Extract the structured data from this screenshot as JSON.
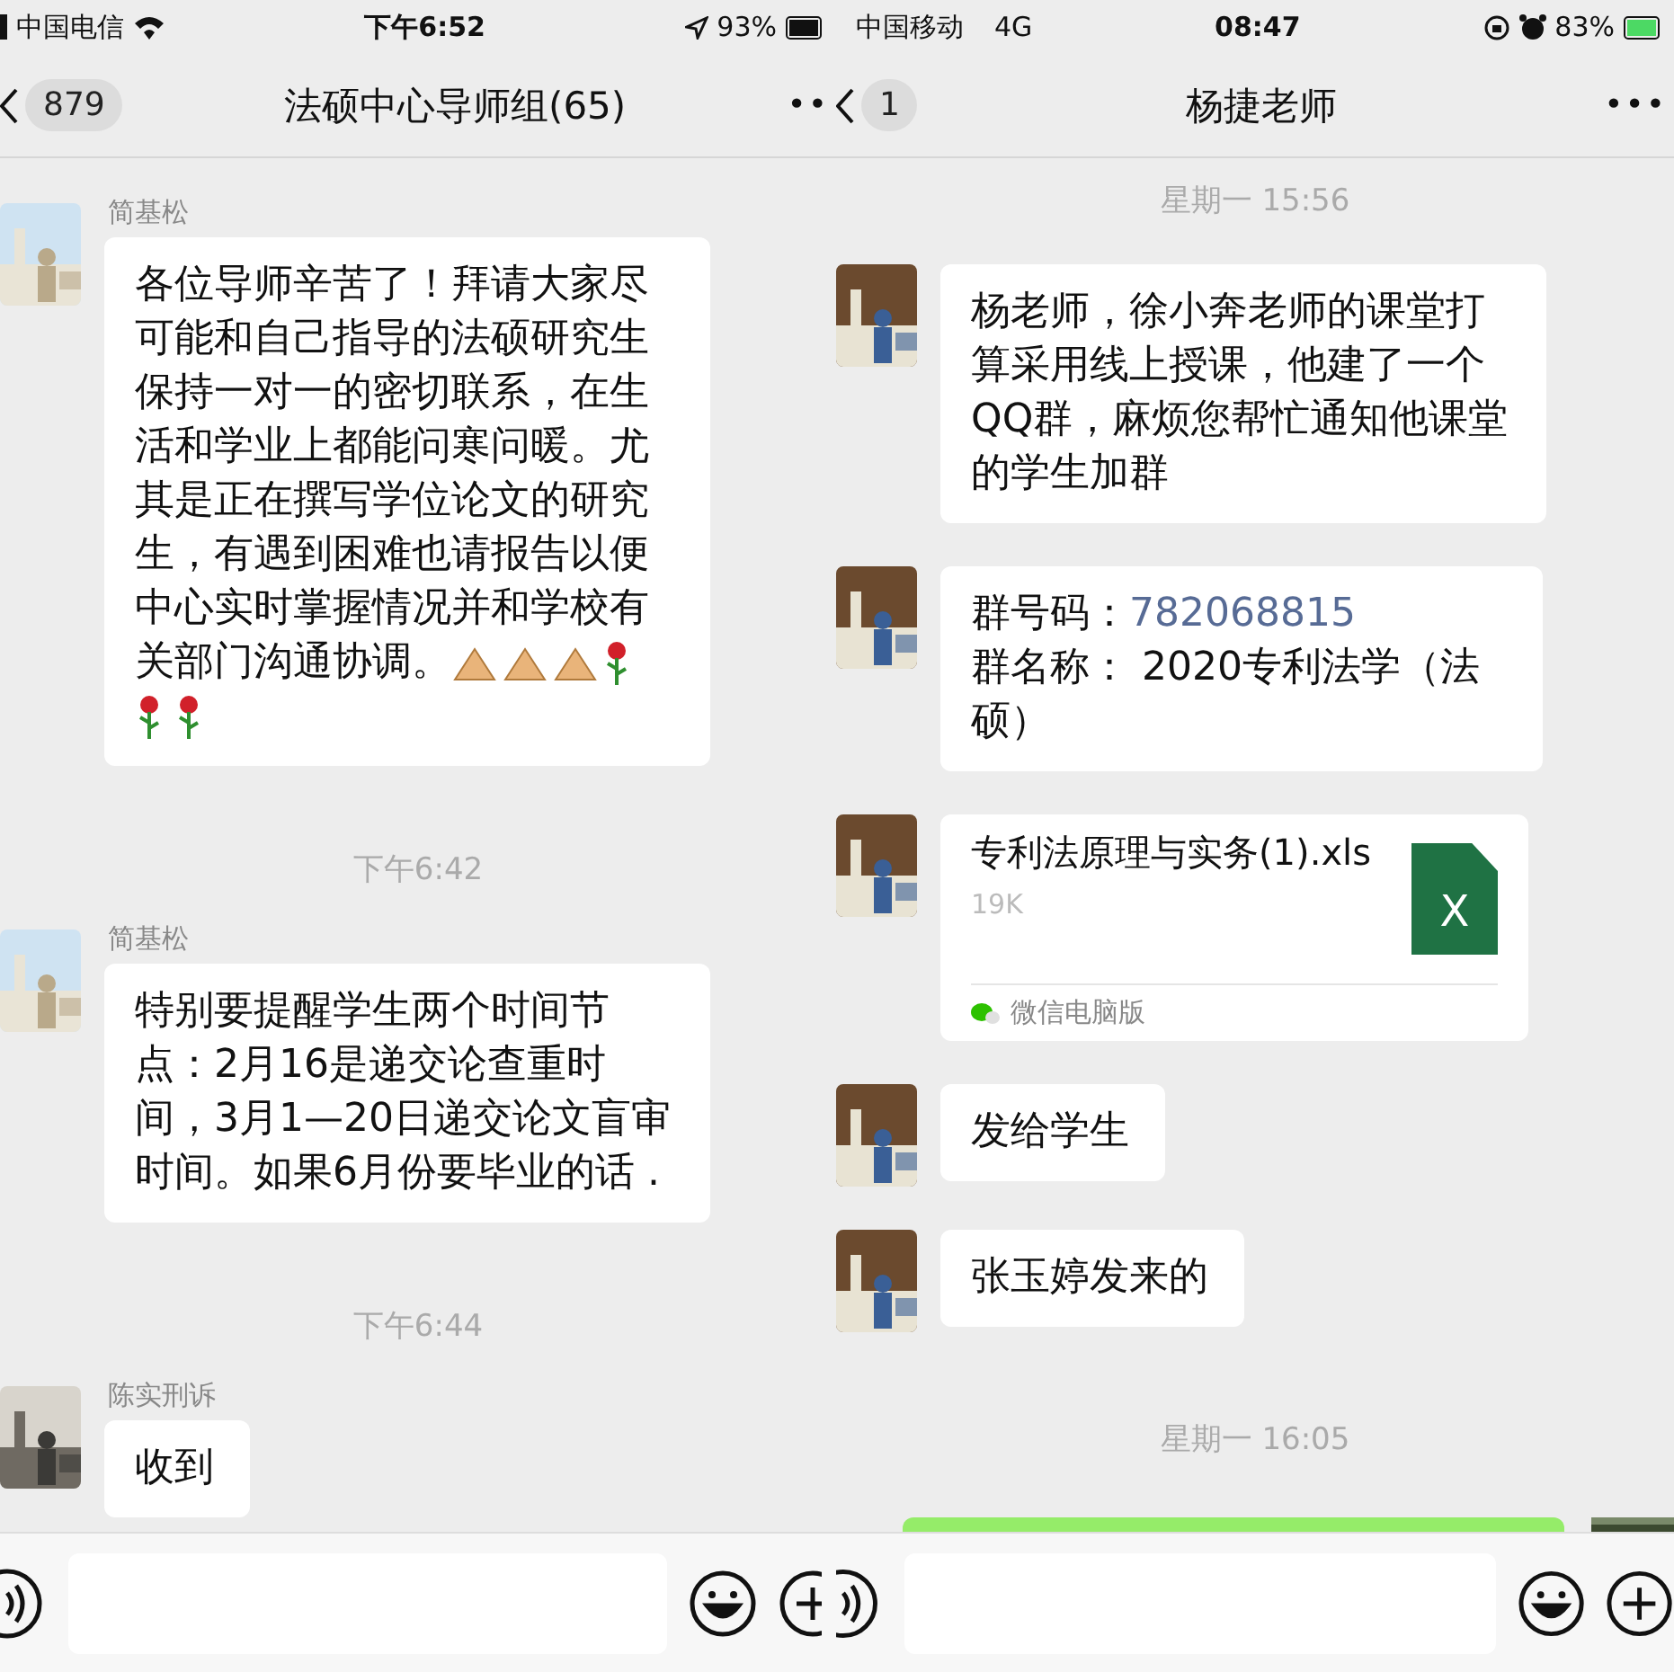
{
  "panes": [
    {
      "status_bar": {
        "kind": "wifi",
        "carrier": "中国电信",
        "time": "下午6:52",
        "battery": "93%"
      },
      "header": {
        "unread": "879",
        "title": "法硕中心导师组(65)",
        "more": "••"
      },
      "messages": [
        {
          "kind": "emoji_text",
          "sender": "简基松",
          "text": "各位导师辛苦了！拜请大家尽可能和自己指导的法硕研究生保持一对一的密切联系，在生活和学业上都能问寒问暖。尤其是正在撰写学位论文的研究生，有遇到困难也请报告以便中心实时掌握情况并和学校有关部门沟通协调。"
        },
        {
          "kind": "time",
          "text": "下午6:42"
        },
        {
          "kind": "text",
          "sender": "简基松",
          "text": "特别要提醒学生两个时间节点：2月16是递交论查重时间，3月1—20日递交论文盲审时间。如果6月份要毕业的话 ."
        },
        {
          "kind": "time",
          "text": "下午6:44"
        },
        {
          "kind": "text",
          "sender": "陈实刑诉",
          "text": "收到"
        }
      ]
    },
    {
      "status_bar": {
        "kind": "cellular",
        "carrier": "中国移动",
        "network": "4G",
        "time": "08:47",
        "battery": "83%"
      },
      "header": {
        "unread": "1",
        "title": "杨捷老师",
        "more": "•••"
      },
      "messages": [
        {
          "kind": "time",
          "text": "星期一 15:56"
        },
        {
          "kind": "text",
          "text": "杨老师，徐小奔老师的课堂打算采用线上授课，他建了一个QQ群，麻烦您帮忙通知他课堂的学生加群"
        },
        {
          "kind": "group",
          "number_label": "群号码：",
          "number": "782068815",
          "name_line": "群名称：  2020专利法学（法硕）"
        },
        {
          "kind": "file",
          "file_name": "专利法原理与实务(1).xls",
          "size": "19K",
          "file_badge": "X",
          "source": "微信电脑版"
        },
        {
          "kind": "text",
          "text": "发给学生"
        },
        {
          "kind": "text",
          "text": "张玉婷发来的"
        },
        {
          "kind": "time",
          "text": "星期一 16:05"
        },
        {
          "kind": "outgoing"
        }
      ]
    }
  ]
}
